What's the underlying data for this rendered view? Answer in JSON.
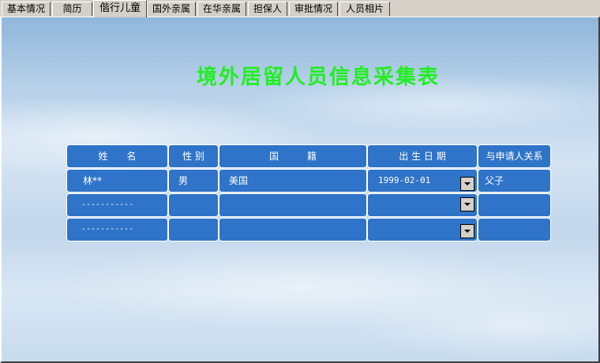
{
  "tabs": [
    {
      "label": "基本情况"
    },
    {
      "label": "简历"
    },
    {
      "label": "偕行儿童",
      "active": true
    },
    {
      "label": "国外亲属"
    },
    {
      "label": "在华亲属"
    },
    {
      "label": "担保人"
    },
    {
      "label": "审批情况"
    },
    {
      "label": "人员相片"
    }
  ],
  "form": {
    "title": "境外居留人员信息采集表"
  },
  "table": {
    "headers": {
      "name": "姓　　名",
      "gender": "性 别",
      "nationality": "国　　　籍",
      "birth_date": "出 生 日 期",
      "relation": "与申请人关系"
    },
    "rows": [
      {
        "name": "林**",
        "gender": "男",
        "nationality": "美国",
        "birth_date": "1999-02-01",
        "relation": "父子"
      },
      {
        "name": "-----------",
        "gender": "",
        "nationality": "",
        "birth_date": "",
        "relation": ""
      },
      {
        "name": "-----------",
        "gender": "",
        "nationality": "",
        "birth_date": "",
        "relation": ""
      }
    ]
  },
  "colors": {
    "title": "#22ee22",
    "cell_bg": "#2f74c8",
    "tab_bg": "#d4d0c8"
  },
  "icons": {
    "dropdown": "chevron-down-icon"
  }
}
